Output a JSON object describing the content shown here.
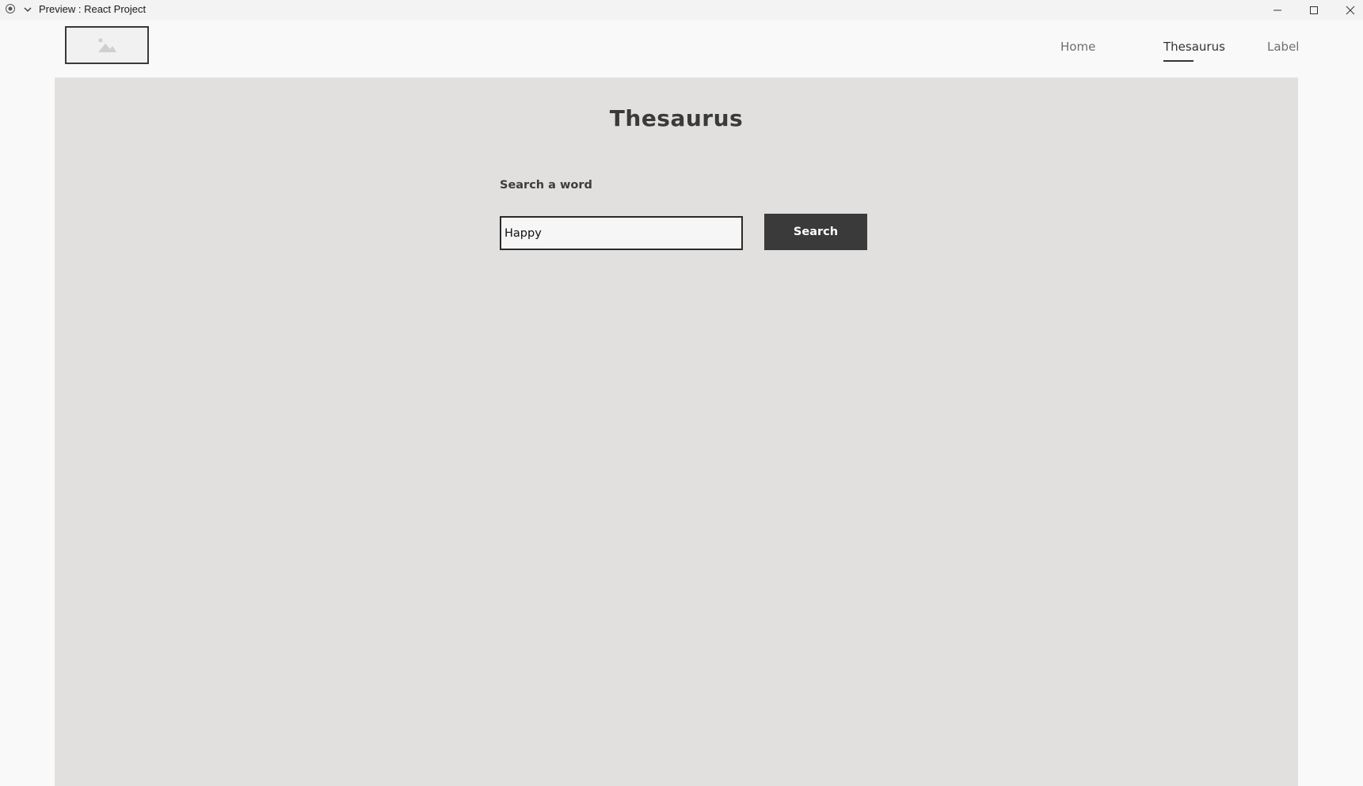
{
  "window": {
    "title": "Preview : React Project",
    "app_icon": "record-circle-icon",
    "menu_icon": "chevron-down-icon",
    "controls": [
      "minimize-icon",
      "maximize-icon",
      "close-icon"
    ]
  },
  "header": {
    "logo_icon": "image-placeholder-icon",
    "nav": [
      {
        "label": "Home",
        "active": false
      },
      {
        "label": "Thesaurus",
        "active": true
      },
      {
        "label": "Label",
        "active": false
      }
    ]
  },
  "main": {
    "title": "Thesaurus",
    "search_label": "Search a word",
    "search_value": "Happy",
    "search_button": "Search"
  },
  "colors": {
    "panel_bg": "#e1e0df",
    "button_bg": "#3a3a3a",
    "page_bg": "#f9f9f9"
  }
}
